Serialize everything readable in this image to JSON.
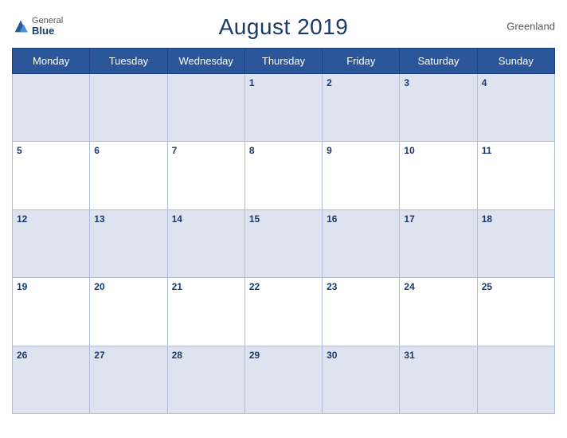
{
  "header": {
    "logo_general": "General",
    "logo_blue": "Blue",
    "title": "August 2019",
    "region": "Greenland"
  },
  "weekdays": [
    "Monday",
    "Tuesday",
    "Wednesday",
    "Thursday",
    "Friday",
    "Saturday",
    "Sunday"
  ],
  "weeks": [
    [
      null,
      null,
      null,
      1,
      2,
      3,
      4
    ],
    [
      5,
      6,
      7,
      8,
      9,
      10,
      11
    ],
    [
      12,
      13,
      14,
      15,
      16,
      17,
      18
    ],
    [
      19,
      20,
      21,
      22,
      23,
      24,
      25
    ],
    [
      26,
      27,
      28,
      29,
      30,
      31,
      null
    ]
  ]
}
